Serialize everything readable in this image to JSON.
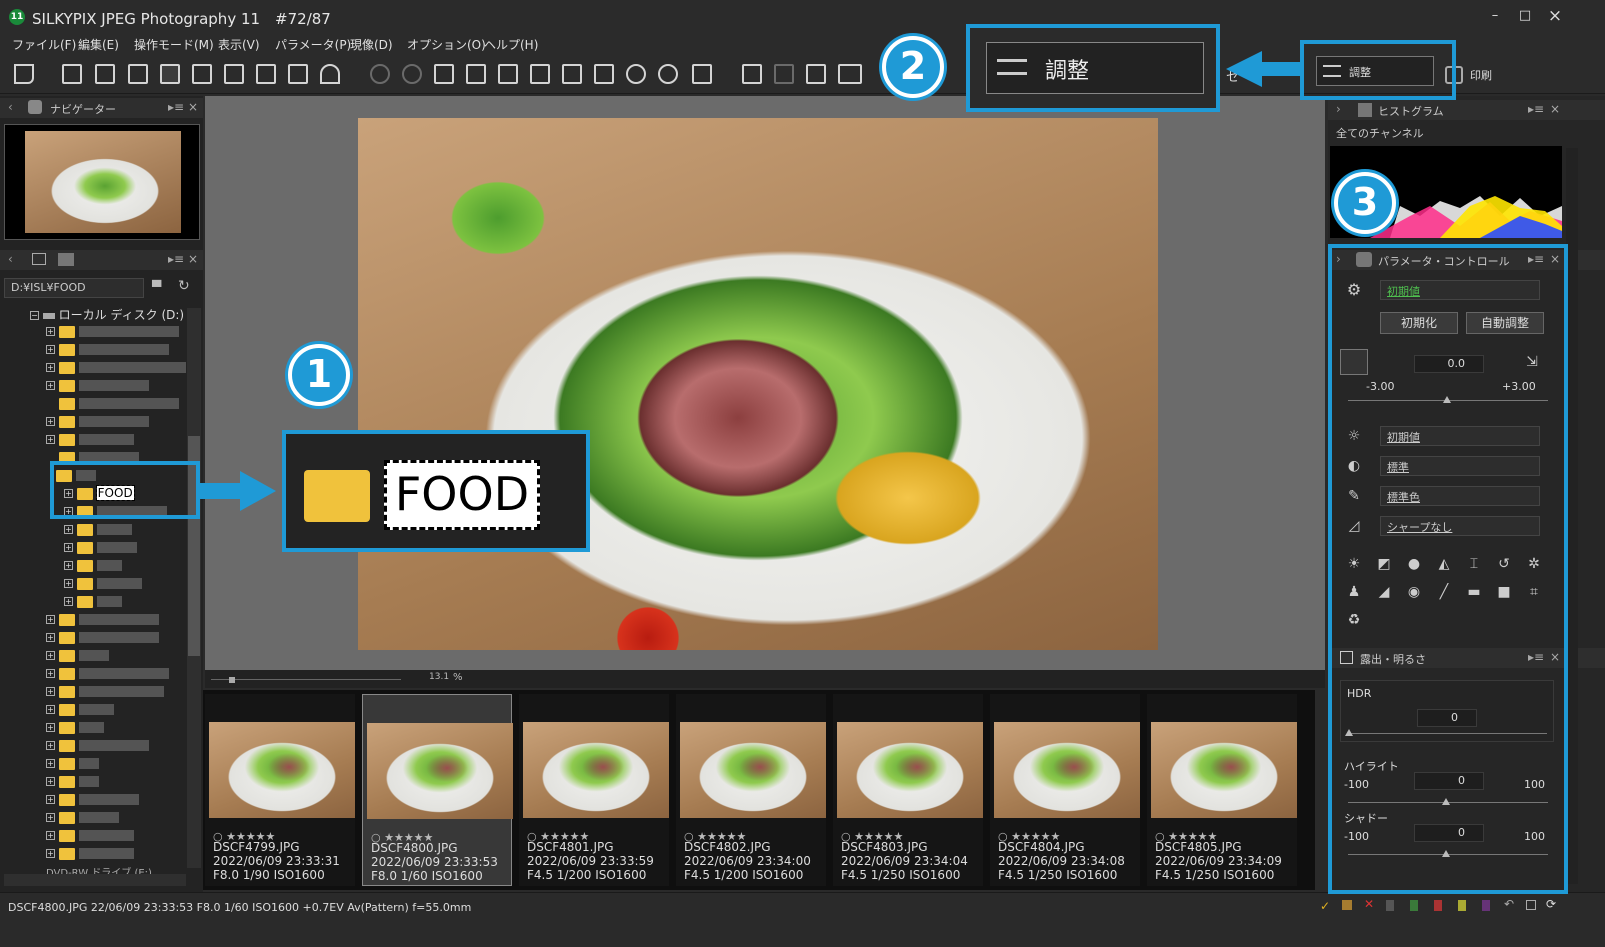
{
  "window": {
    "title": "SILKYPIX JPEG Photography 11　#72/87",
    "app_icon": "11",
    "minimize": "–",
    "maximize": "□",
    "close": "×"
  },
  "menu": [
    "ファイル(F)",
    "編集(E)",
    "操作モード(M)",
    "表示(V)",
    "パラメータ(P)",
    "現像(D)",
    "オプション(O)",
    "ヘルプ(H)"
  ],
  "toolbar": {
    "adjust_label": "調整",
    "print_label": "印刷",
    "partial_label": "セ"
  },
  "navigator": {
    "title": "ナビゲーター"
  },
  "folder_panel": {
    "path": "D:¥ISL¥FOOD",
    "drive": "ローカル ディスク (D:)",
    "selected": "FOOD",
    "dvd": "DVD-RW ドライブ (E:)"
  },
  "viewer": {
    "zoom": "13.1",
    "zoom_unit": "%"
  },
  "thumbnails": [
    {
      "name": "DSCF4799.JPG",
      "date": "2022/06/09 23:33:31",
      "exif": "F8.0 1/90 ISO1600",
      "stars": "○ ★★★★★"
    },
    {
      "name": "DSCF4800.JPG",
      "date": "2022/06/09 23:33:53",
      "exif": "F8.0 1/60 ISO1600",
      "stars": "○ ★★★★★"
    },
    {
      "name": "DSCF4801.JPG",
      "date": "2022/06/09 23:33:59",
      "exif": "F4.5 1/200 ISO1600",
      "stars": "○ ★★★★★"
    },
    {
      "name": "DSCF4802.JPG",
      "date": "2022/06/09 23:34:00",
      "exif": "F4.5 1/200 ISO1600",
      "stars": "○ ★★★★★"
    },
    {
      "name": "DSCF4803.JPG",
      "date": "2022/06/09 23:34:04",
      "exif": "F4.5 1/250 ISO1600",
      "stars": "○ ★★★★★"
    },
    {
      "name": "DSCF4804.JPG",
      "date": "2022/06/09 23:34:08",
      "exif": "F4.5 1/250 ISO1600",
      "stars": "○ ★★★★★"
    },
    {
      "name": "DSCF4805.JPG",
      "date": "2022/06/09 23:34:09",
      "exif": "F4.5 1/250 ISO1600",
      "stars": "○ ★★★★★"
    }
  ],
  "selected_thumbnail_index": 1,
  "histogram": {
    "title": "ヒストグラム",
    "channel": "全てのチャンネル"
  },
  "param_control": {
    "title": "パラメータ・コントロール",
    "taste": "初期値",
    "reset": "初期化",
    "auto": "自動調整",
    "exposure_value": "0.0",
    "exposure_min": "-3.00",
    "exposure_max": "+3.00",
    "wb": "初期値",
    "tone": "標準",
    "color": "標準色",
    "sharp": "シャープなし"
  },
  "exposure_panel": {
    "title": "露出・明るさ",
    "hdr_label": "HDR",
    "hdr_value": "0",
    "highlight_label": "ハイライト",
    "highlight_value": "0",
    "highlight_min": "-100",
    "highlight_max": "100",
    "shadow_label": "シャドー",
    "shadow_value": "0",
    "shadow_min": "-100",
    "shadow_max": "100"
  },
  "status": "DSCF4800.JPG 22/06/09 23:33:53 F8.0 1/60 ISO1600 +0.7EV Av(Pattern) f=55.0mm",
  "callouts": {
    "one": "1",
    "two": "2",
    "three": "3",
    "food_zoom": "FOOD",
    "adjust_zoom": "調整"
  },
  "colors": {
    "accent": "#1f9ad6",
    "folder": "#f0c23c",
    "green_text": "#4fbf4f"
  }
}
